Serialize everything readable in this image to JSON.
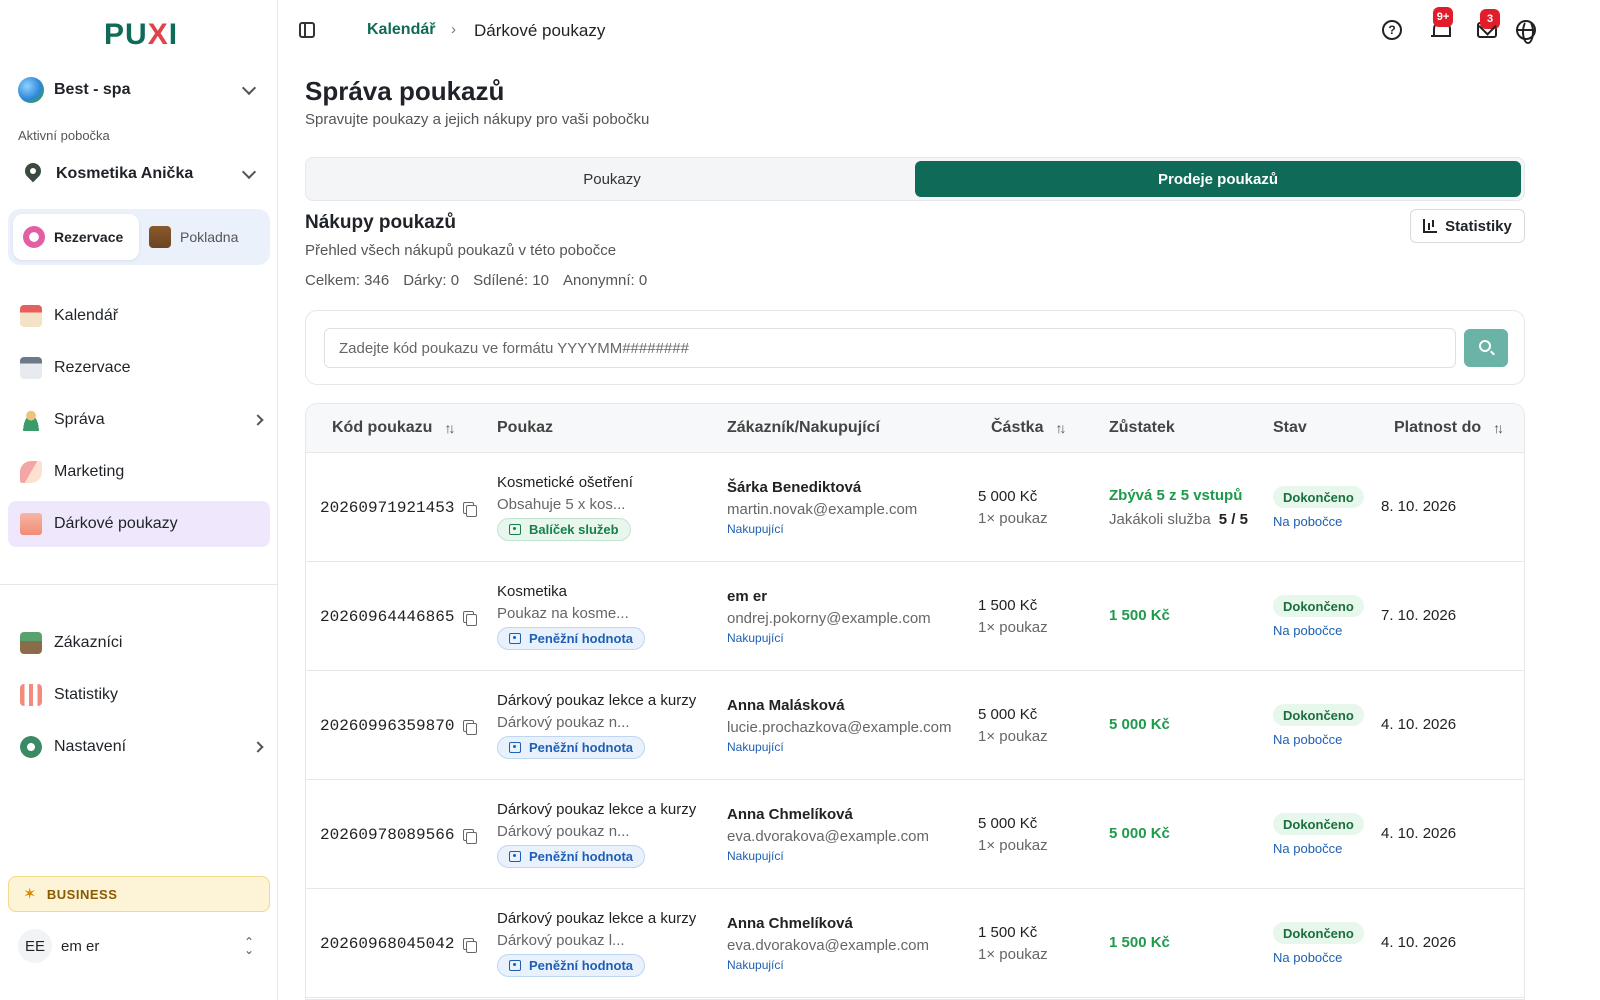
{
  "sidebar": {
    "logo": {
      "pre": "PU",
      "x": "X",
      "post": "I"
    },
    "company": "Best - spa",
    "branch_label": "Aktivní pobočka",
    "branch": "Kosmetika Anička",
    "modes": [
      {
        "label": "Rezervace",
        "icon": "reservation-icon",
        "active": true
      },
      {
        "label": "Pokladna",
        "icon": "cash-register-icon",
        "active": false
      }
    ],
    "nav": [
      {
        "label": "Kalendář",
        "icon": "calendar-icon"
      },
      {
        "label": "Rezervace",
        "icon": "reservations-icon"
      },
      {
        "label": "Správa",
        "icon": "management-icon",
        "has_children": true
      },
      {
        "label": "Marketing",
        "icon": "megaphone-icon"
      },
      {
        "label": "Dárkové poukazy",
        "icon": "gift-voucher-icon",
        "active": true
      },
      {
        "label": "Zákazníci",
        "icon": "customers-icon"
      },
      {
        "label": "Statistiky",
        "icon": "statistics-icon"
      },
      {
        "label": "Nastavení",
        "icon": "settings-icon",
        "has_children": true
      }
    ],
    "plan": "BUSINESS",
    "user": {
      "initials": "EE",
      "name": "em er"
    }
  },
  "topbar": {
    "breadcrumb": [
      "Kalendář",
      "Dárkové poukazy"
    ],
    "notifications_badge": "9+",
    "messages_badge": "3"
  },
  "page": {
    "title": "Správa poukazů",
    "subtitle": "Spravujte poukazy a jejich nákupy pro vaši pobočku",
    "tabs": [
      {
        "label": "Poukazy",
        "active": false
      },
      {
        "label": "Prodeje poukazů",
        "active": true
      }
    ],
    "section_title": "Nákupy poukazů",
    "section_subtitle": "Přehled všech nákupů poukazů v této pobočce",
    "counts": [
      "Celkem: 346",
      "Dárky: 0",
      "Sdílené: 10",
      "Anonymní: 0"
    ],
    "stats_button": "Statistiky",
    "search_placeholder": "Zadejte kód poukazu ve formátu YYYYMM########"
  },
  "table": {
    "columns": [
      "Kód poukazu",
      "Poukaz",
      "Zákazník/Nakupující",
      "Částka",
      "Zůstatek",
      "Stav",
      "Platnost do"
    ],
    "rows": [
      {
        "code": "20260971921453",
        "voucher": "Kosmetické ošetření",
        "description": "Obsahuje 5 x kos...",
        "type": "Balíček služeb",
        "customer": "Šárka Benediktová",
        "email": "martin.novak@example.com",
        "role": "Nakupující",
        "amount": "5 000 Kč",
        "qty": "1× poukaz",
        "balance": "Zbývá 5 z 5 vstupů",
        "balance_note": "Jakákoli služba",
        "balance_ratio": "5 / 5",
        "status": "Dokončeno",
        "location": "Na pobočce",
        "valid_to": "8. 10. 2026"
      },
      {
        "code": "20260964446865",
        "voucher": "Kosmetika",
        "description": "Poukaz na kosme...",
        "type": "Peněžní hodnota",
        "customer": "em er",
        "email": "ondrej.pokorny@example.com",
        "role": "Nakupující",
        "amount": "1 500 Kč",
        "qty": "1× poukaz",
        "balance": "1 500 Kč",
        "status": "Dokončeno",
        "location": "Na pobočce",
        "valid_to": "7. 10. 2026"
      },
      {
        "code": "20260996359870",
        "voucher": "Dárkový poukaz lekce a kurzy",
        "description": "Dárkový poukaz n...",
        "type": "Peněžní hodnota",
        "customer": "Anna Malásková",
        "email": "lucie.prochazkova@example.com",
        "role": "Nakupující",
        "amount": "5 000 Kč",
        "qty": "1× poukaz",
        "balance": "5 000 Kč",
        "status": "Dokončeno",
        "location": "Na pobočce",
        "valid_to": "4. 10. 2026"
      },
      {
        "code": "20260978089566",
        "voucher": "Dárkový poukaz lekce a kurzy",
        "description": "Dárkový poukaz n...",
        "type": "Peněžní hodnota",
        "customer": "Anna Chmelíková",
        "email": "eva.dvorakova@example.com",
        "role": "Nakupující",
        "amount": "5 000 Kč",
        "qty": "1× poukaz",
        "balance": "5 000 Kč",
        "status": "Dokončeno",
        "location": "Na pobočce",
        "valid_to": "4. 10. 2026"
      },
      {
        "code": "20260968045042",
        "voucher": "Dárkový poukaz lekce a kurzy",
        "description": "Dárkový poukaz l...",
        "type": "Peněžní hodnota",
        "customer": "Anna Chmelíková",
        "email": "eva.dvorakova@example.com",
        "role": "Nakupující",
        "amount": "1 500 Kč",
        "qty": "1× poukaz",
        "balance": "1 500 Kč",
        "status": "Dokončeno",
        "location": "Na pobočce",
        "valid_to": "4. 10. 2026"
      }
    ]
  },
  "colors": {
    "brand": "#0f6b57",
    "accent_red": "#e0434a",
    "active_nav": "#efe7fb",
    "balance_green": "#1e9a4b",
    "link_blue": "#1e5fb3"
  }
}
